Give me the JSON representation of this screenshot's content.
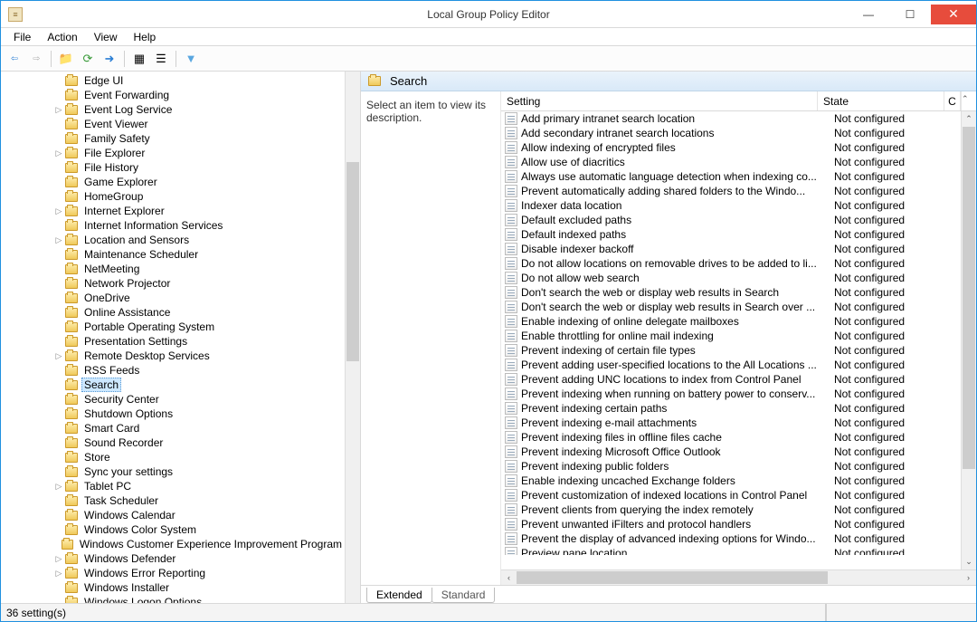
{
  "window": {
    "title": "Local Group Policy Editor"
  },
  "menu": {
    "file": "File",
    "action": "Action",
    "view": "View",
    "help": "Help"
  },
  "tree": {
    "items": [
      {
        "label": "Edge UI",
        "indent": 72,
        "expander": ""
      },
      {
        "label": "Event Forwarding",
        "indent": 72,
        "expander": ""
      },
      {
        "label": "Event Log Service",
        "indent": 72,
        "expander": "▷"
      },
      {
        "label": "Event Viewer",
        "indent": 72,
        "expander": ""
      },
      {
        "label": "Family Safety",
        "indent": 72,
        "expander": ""
      },
      {
        "label": "File Explorer",
        "indent": 72,
        "expander": "▷"
      },
      {
        "label": "File History",
        "indent": 72,
        "expander": ""
      },
      {
        "label": "Game Explorer",
        "indent": 72,
        "expander": ""
      },
      {
        "label": "HomeGroup",
        "indent": 72,
        "expander": ""
      },
      {
        "label": "Internet Explorer",
        "indent": 72,
        "expander": "▷"
      },
      {
        "label": "Internet Information Services",
        "indent": 72,
        "expander": ""
      },
      {
        "label": "Location and Sensors",
        "indent": 72,
        "expander": "▷"
      },
      {
        "label": "Maintenance Scheduler",
        "indent": 72,
        "expander": ""
      },
      {
        "label": "NetMeeting",
        "indent": 72,
        "expander": ""
      },
      {
        "label": "Network Projector",
        "indent": 72,
        "expander": ""
      },
      {
        "label": "OneDrive",
        "indent": 72,
        "expander": ""
      },
      {
        "label": "Online Assistance",
        "indent": 72,
        "expander": ""
      },
      {
        "label": "Portable Operating System",
        "indent": 72,
        "expander": ""
      },
      {
        "label": "Presentation Settings",
        "indent": 72,
        "expander": ""
      },
      {
        "label": "Remote Desktop Services",
        "indent": 72,
        "expander": "▷"
      },
      {
        "label": "RSS Feeds",
        "indent": 72,
        "expander": ""
      },
      {
        "label": "Search",
        "indent": 72,
        "expander": "",
        "selected": true
      },
      {
        "label": "Security Center",
        "indent": 72,
        "expander": ""
      },
      {
        "label": "Shutdown Options",
        "indent": 72,
        "expander": ""
      },
      {
        "label": "Smart Card",
        "indent": 72,
        "expander": ""
      },
      {
        "label": "Sound Recorder",
        "indent": 72,
        "expander": ""
      },
      {
        "label": "Store",
        "indent": 72,
        "expander": ""
      },
      {
        "label": "Sync your settings",
        "indent": 72,
        "expander": ""
      },
      {
        "label": "Tablet PC",
        "indent": 72,
        "expander": "▷"
      },
      {
        "label": "Task Scheduler",
        "indent": 72,
        "expander": ""
      },
      {
        "label": "Windows Calendar",
        "indent": 72,
        "expander": ""
      },
      {
        "label": "Windows Color System",
        "indent": 72,
        "expander": ""
      },
      {
        "label": "Windows Customer Experience Improvement Program",
        "indent": 72,
        "expander": ""
      },
      {
        "label": "Windows Defender",
        "indent": 72,
        "expander": "▷"
      },
      {
        "label": "Windows Error Reporting",
        "indent": 72,
        "expander": "▷"
      },
      {
        "label": "Windows Installer",
        "indent": 72,
        "expander": ""
      },
      {
        "label": "Windows Logon Options",
        "indent": 72,
        "expander": ""
      }
    ]
  },
  "right": {
    "heading": "Search",
    "description": "Select an item to view its description.",
    "columns": {
      "setting": "Setting",
      "state": "State",
      "c": "C"
    },
    "settings": [
      {
        "name": "Add primary intranet search location",
        "state": "Not configured"
      },
      {
        "name": "Add secondary intranet search locations",
        "state": "Not configured"
      },
      {
        "name": "Allow indexing of encrypted files",
        "state": "Not configured"
      },
      {
        "name": "Allow use of diacritics",
        "state": "Not configured"
      },
      {
        "name": "Always use automatic language detection when indexing co...",
        "state": "Not configured"
      },
      {
        "name": "Prevent automatically adding shared folders to the Windo...",
        "state": "Not configured"
      },
      {
        "name": "Indexer data location",
        "state": "Not configured"
      },
      {
        "name": "Default excluded paths",
        "state": "Not configured"
      },
      {
        "name": "Default indexed paths",
        "state": "Not configured"
      },
      {
        "name": "Disable indexer backoff",
        "state": "Not configured"
      },
      {
        "name": "Do not allow locations on removable drives to be added to li...",
        "state": "Not configured"
      },
      {
        "name": "Do not allow web search",
        "state": "Not configured"
      },
      {
        "name": "Don't search the web or display web results in Search",
        "state": "Not configured"
      },
      {
        "name": "Don't search the web or display web results in Search over ...",
        "state": "Not configured"
      },
      {
        "name": "Enable indexing of online delegate mailboxes",
        "state": "Not configured"
      },
      {
        "name": "Enable throttling for online mail indexing",
        "state": "Not configured"
      },
      {
        "name": "Prevent indexing of certain file types",
        "state": "Not configured"
      },
      {
        "name": "Prevent adding user-specified locations to the All Locations ...",
        "state": "Not configured"
      },
      {
        "name": "Prevent adding UNC locations to index from Control Panel",
        "state": "Not configured"
      },
      {
        "name": "Prevent indexing when running on battery power to conserv...",
        "state": "Not configured"
      },
      {
        "name": "Prevent indexing certain paths",
        "state": "Not configured"
      },
      {
        "name": "Prevent indexing e-mail attachments",
        "state": "Not configured"
      },
      {
        "name": "Prevent indexing files in offline files cache",
        "state": "Not configured"
      },
      {
        "name": "Prevent indexing Microsoft Office Outlook",
        "state": "Not configured"
      },
      {
        "name": "Prevent indexing public folders",
        "state": "Not configured"
      },
      {
        "name": "Enable indexing uncached Exchange folders",
        "state": "Not configured"
      },
      {
        "name": "Prevent customization of indexed locations in Control Panel",
        "state": "Not configured"
      },
      {
        "name": "Prevent clients from querying the index remotely",
        "state": "Not configured"
      },
      {
        "name": "Prevent unwanted iFilters and protocol handlers",
        "state": "Not configured"
      },
      {
        "name": "Prevent the display of advanced indexing options for Windo...",
        "state": "Not configured"
      },
      {
        "name": "Preview pane location",
        "state": "Not configured"
      }
    ]
  },
  "tabs": {
    "extended": "Extended",
    "standard": "Standard"
  },
  "status": {
    "text": "36 setting(s)"
  }
}
